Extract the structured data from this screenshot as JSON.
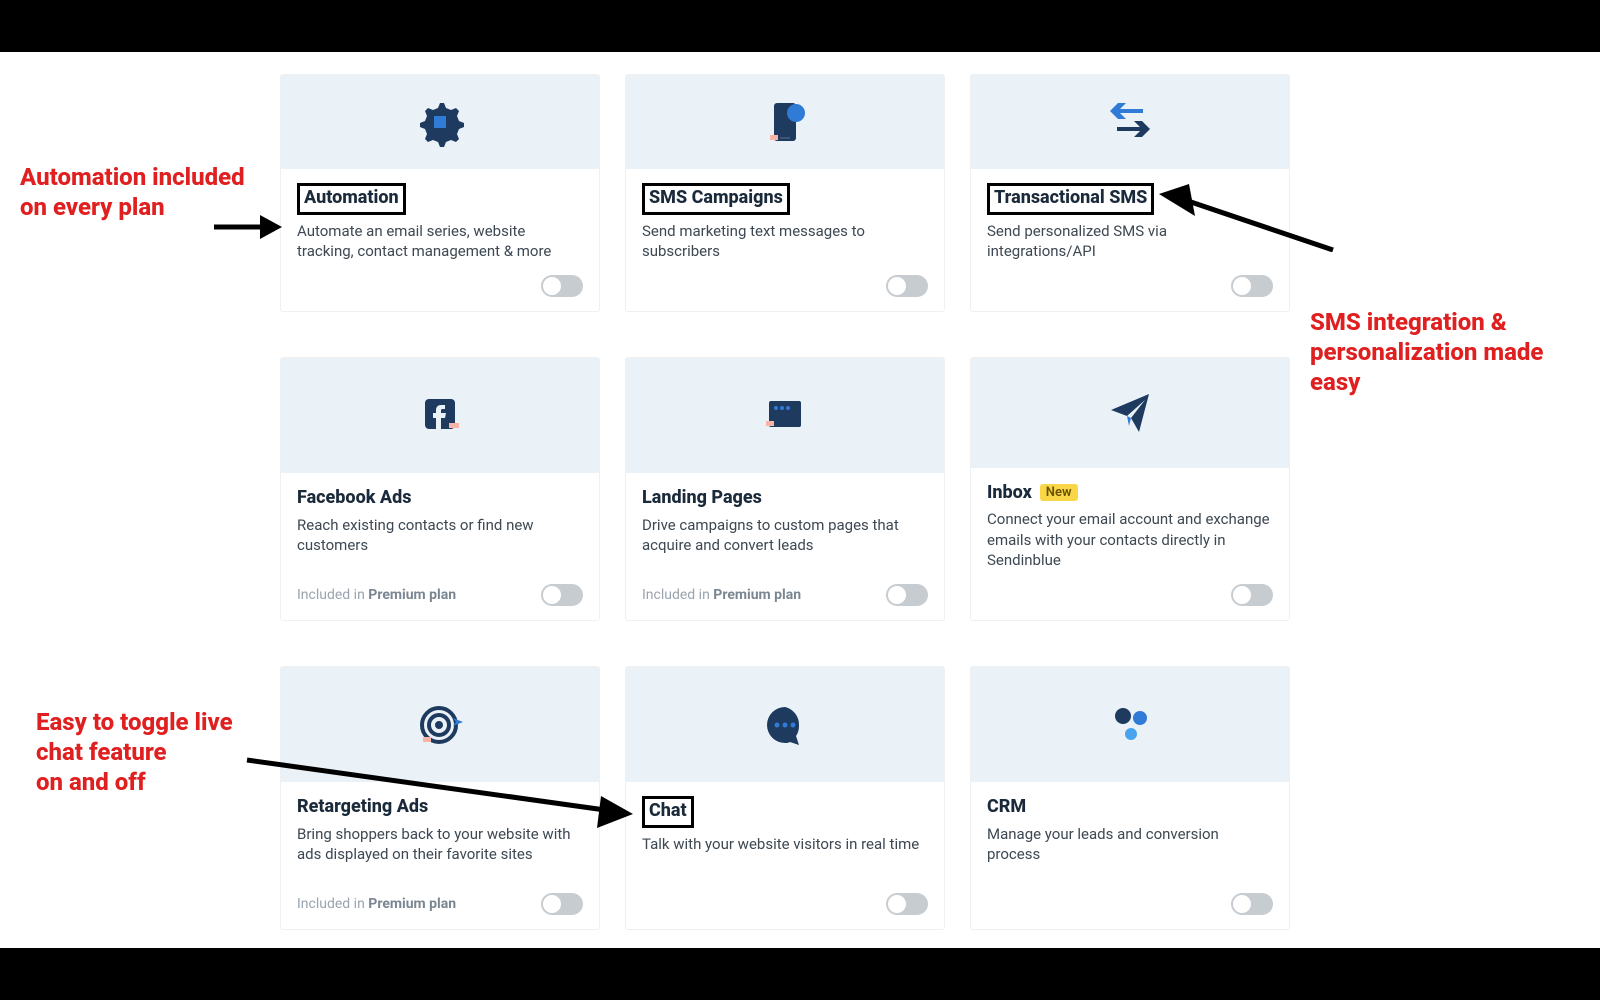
{
  "annotations": {
    "a1": "Automation included on every plan",
    "a2": "SMS integration & personalization made easy",
    "a3": "Easy to toggle live chat feature\non and off"
  },
  "included_prefix": "Included in ",
  "included_plan": "Premium plan",
  "cards": {
    "automation": {
      "title": "Automation",
      "desc": "Automate an email series, website tracking, contact management & more"
    },
    "sms_campaigns": {
      "title": "SMS Campaigns",
      "desc": "Send marketing text messages to subscribers"
    },
    "transactional": {
      "title": "Transactional SMS",
      "desc": "Send personalized SMS via integrations/API"
    },
    "facebook_ads": {
      "title": "Facebook Ads",
      "desc": "Reach existing contacts or find new customers"
    },
    "landing_pages": {
      "title": "Landing Pages",
      "desc": "Drive campaigns to custom pages that acquire and convert leads"
    },
    "inbox": {
      "title": "Inbox",
      "badge": "New",
      "desc": "Connect your email account and exchange emails with your contacts directly in Sendinblue"
    },
    "retargeting": {
      "title": "Retargeting Ads",
      "desc": "Bring shoppers back to your website with ads displayed on their favorite sites"
    },
    "chat": {
      "title": "Chat",
      "desc": "Talk with your website visitors in real time"
    },
    "crm": {
      "title": "CRM",
      "desc": "Manage your leads and conversion process"
    }
  }
}
